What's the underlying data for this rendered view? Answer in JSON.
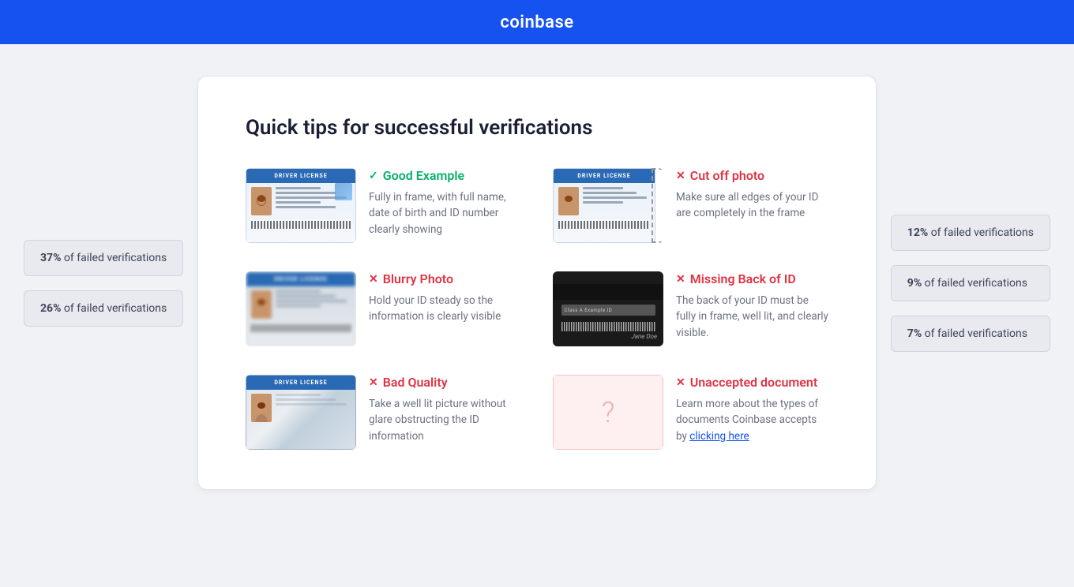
{
  "header": {
    "logo": "coinbase"
  },
  "page": {
    "title": "Quick tips for successful verifications"
  },
  "left_stats": [
    {
      "id": "stat-37",
      "value": "37%",
      "label": "of failed verifications"
    },
    {
      "id": "stat-26",
      "value": "26%",
      "label": "of failed verifications"
    }
  ],
  "right_stats": [
    {
      "id": "stat-12",
      "value": "12%",
      "label": "of failed verifications"
    },
    {
      "id": "stat-9",
      "value": "9%",
      "label": "of failed verifications"
    },
    {
      "id": "stat-7",
      "value": "7%",
      "label": "of failed verifications"
    }
  ],
  "tips": [
    {
      "id": "good-example",
      "type": "good",
      "icon": "✓",
      "title": "Good Example",
      "description": "Fully in frame, with full name, date of birth and ID number clearly showing",
      "image_type": "good"
    },
    {
      "id": "cut-off-photo",
      "type": "bad",
      "icon": "✕",
      "title": "Cut off photo",
      "description": "Make sure all edges of your ID are completely in the frame",
      "image_type": "cutoff"
    },
    {
      "id": "blurry-photo",
      "type": "bad",
      "icon": "✕",
      "title": "Blurry Photo",
      "description": "Hold your ID steady so the information is clearly visible",
      "image_type": "blurry"
    },
    {
      "id": "missing-back",
      "type": "bad",
      "icon": "✕",
      "title": "Missing Back of ID",
      "description": "The back of your ID must be fully in frame, well lit, and clearly visible.",
      "image_type": "back"
    },
    {
      "id": "bad-quality",
      "type": "bad",
      "icon": "✕",
      "title": "Bad Quality",
      "description": "Take a well lit picture without glare obstructing the ID information",
      "image_type": "badquality"
    },
    {
      "id": "unaccepted-document",
      "type": "bad",
      "icon": "✕",
      "title": "Unaccepted document",
      "description": "Learn more about the types of documents Coinbase accepts by",
      "link_text": "clicking here",
      "image_type": "unaccepted"
    }
  ],
  "id_header_text": "DRIVER LICENSE",
  "colors": {
    "header_bg": "#1652f0",
    "good": "#05b169",
    "bad": "#e03444",
    "stat_bg": "#e8eaf0"
  }
}
